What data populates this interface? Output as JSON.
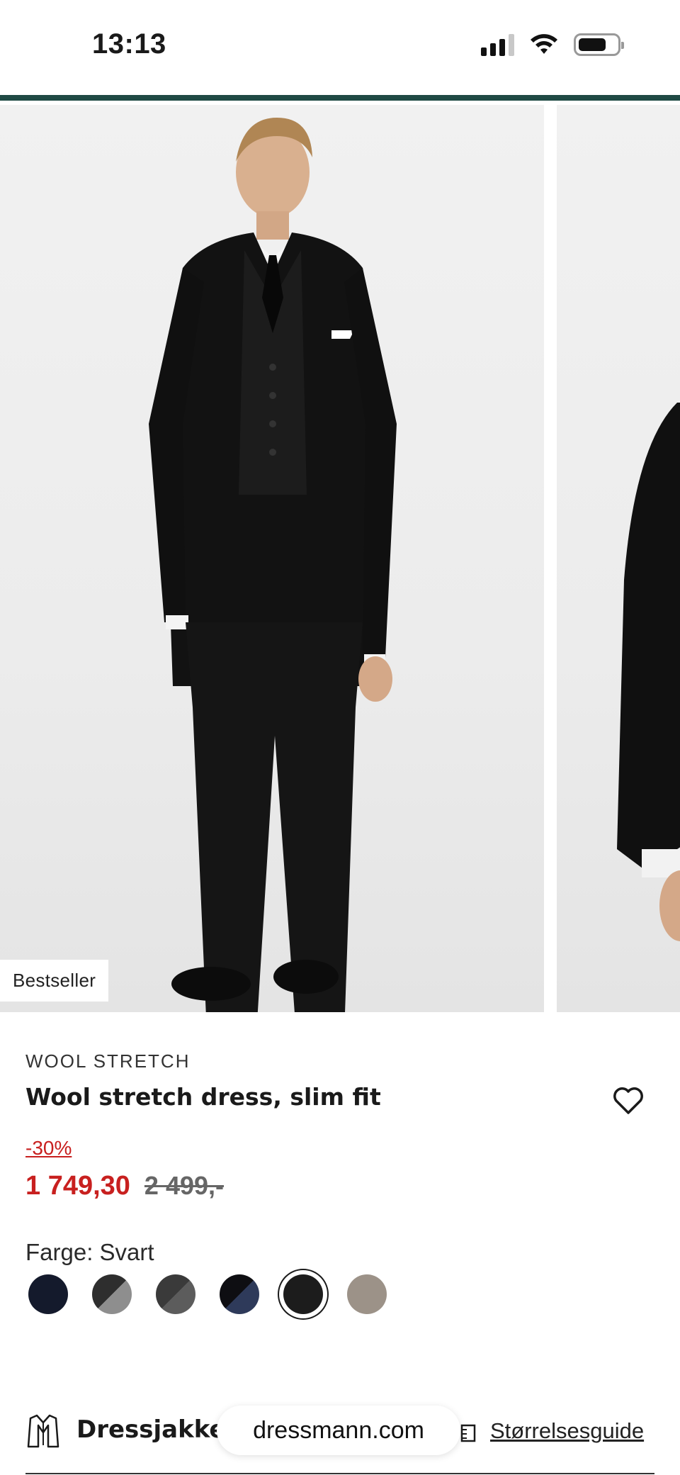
{
  "status_bar": {
    "time": "13:13"
  },
  "gallery": {
    "badge": "Bestseller",
    "model_image": "model-in-black-suit-image"
  },
  "product": {
    "brand": "WOOL STRETCH",
    "title": "Wool stretch dress, slim fit",
    "discount": "-30%",
    "price_now": "1 749,30",
    "price_old": "2 499,-"
  },
  "color": {
    "label": "Farge: Svart",
    "swatches": [
      {
        "name": "navy",
        "color": "#141a2c",
        "selected": false
      },
      {
        "name": "dark-grey-split",
        "color": "#3a3a3a",
        "selected": false
      },
      {
        "name": "charcoal-split",
        "color": "#4a4a4a",
        "selected": false
      },
      {
        "name": "black-blue-split",
        "color": "#12141c",
        "selected": false
      },
      {
        "name": "black",
        "color": "#1c1c1c",
        "selected": true
      },
      {
        "name": "taupe",
        "color": "#9c9288",
        "selected": false
      }
    ]
  },
  "bottom_bar": {
    "category": "Dressjakke",
    "url": "dressmann.com",
    "size_guide": "Størrelsesguide"
  },
  "colors": {
    "accent_divider": "#1f4a44",
    "sale_red": "#c8201f"
  }
}
